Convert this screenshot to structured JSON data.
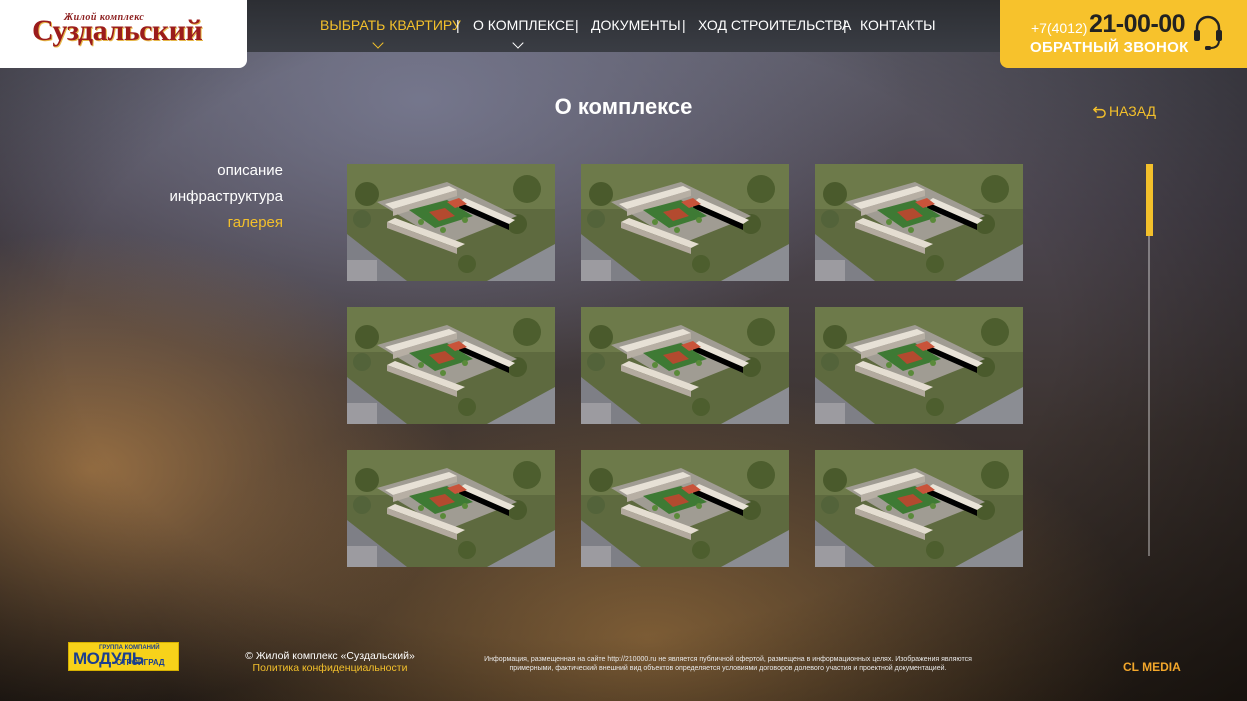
{
  "header": {
    "logo_top": "Жилой комплекс",
    "logo_main": "Суздальский",
    "phone_prefix": "+7(4012)",
    "phone_number": "21-00-00",
    "callback_label": "ОБРАТНЫЙ ЗВОНОК"
  },
  "nav": [
    {
      "label": "ВЫБРАТЬ КВАРТИРУ",
      "active": true,
      "dropdown": true
    },
    {
      "label": "О КОМПЛЕКСЕ",
      "active": false,
      "dropdown": true
    },
    {
      "label": "ДОКУМЕНТЫ",
      "active": false,
      "dropdown": false
    },
    {
      "label": "ХОД СТРОИТЕЛЬСТВА",
      "active": false,
      "dropdown": false
    },
    {
      "label": "КОНТАКТЫ",
      "active": false,
      "dropdown": false
    }
  ],
  "page": {
    "title": "О комплексе",
    "back_label": "НАЗАД"
  },
  "side_menu": [
    {
      "label": "описание",
      "active": false
    },
    {
      "label": "инфраструктура",
      "active": false
    },
    {
      "label": "галерея",
      "active": true
    }
  ],
  "gallery": {
    "count": 9,
    "thumb_icon": "aerial-render-image"
  },
  "footer": {
    "partner_small": "ГРУППА КОМПАНИЙ",
    "partner_main": "МОДУЛЬ",
    "partner_sub": "СТРОЙГРАД",
    "copyright": "© Жилой комплекс «Суздальский»",
    "policy": "Политика конфиденциальности",
    "disclaimer": "Информация, размещенная на сайте http://210000.ru не является публичной офертой, размещена в информационных целях. Изображения являются примерными, фактический внешний вид объектов определяется условиями договоров долевого участия и проектной документацией.",
    "studio": "CL MEDIA"
  },
  "colors": {
    "accent": "#f3c02b",
    "phone_bg": "#f7c22c",
    "logo_red": "#9b1c1c"
  }
}
